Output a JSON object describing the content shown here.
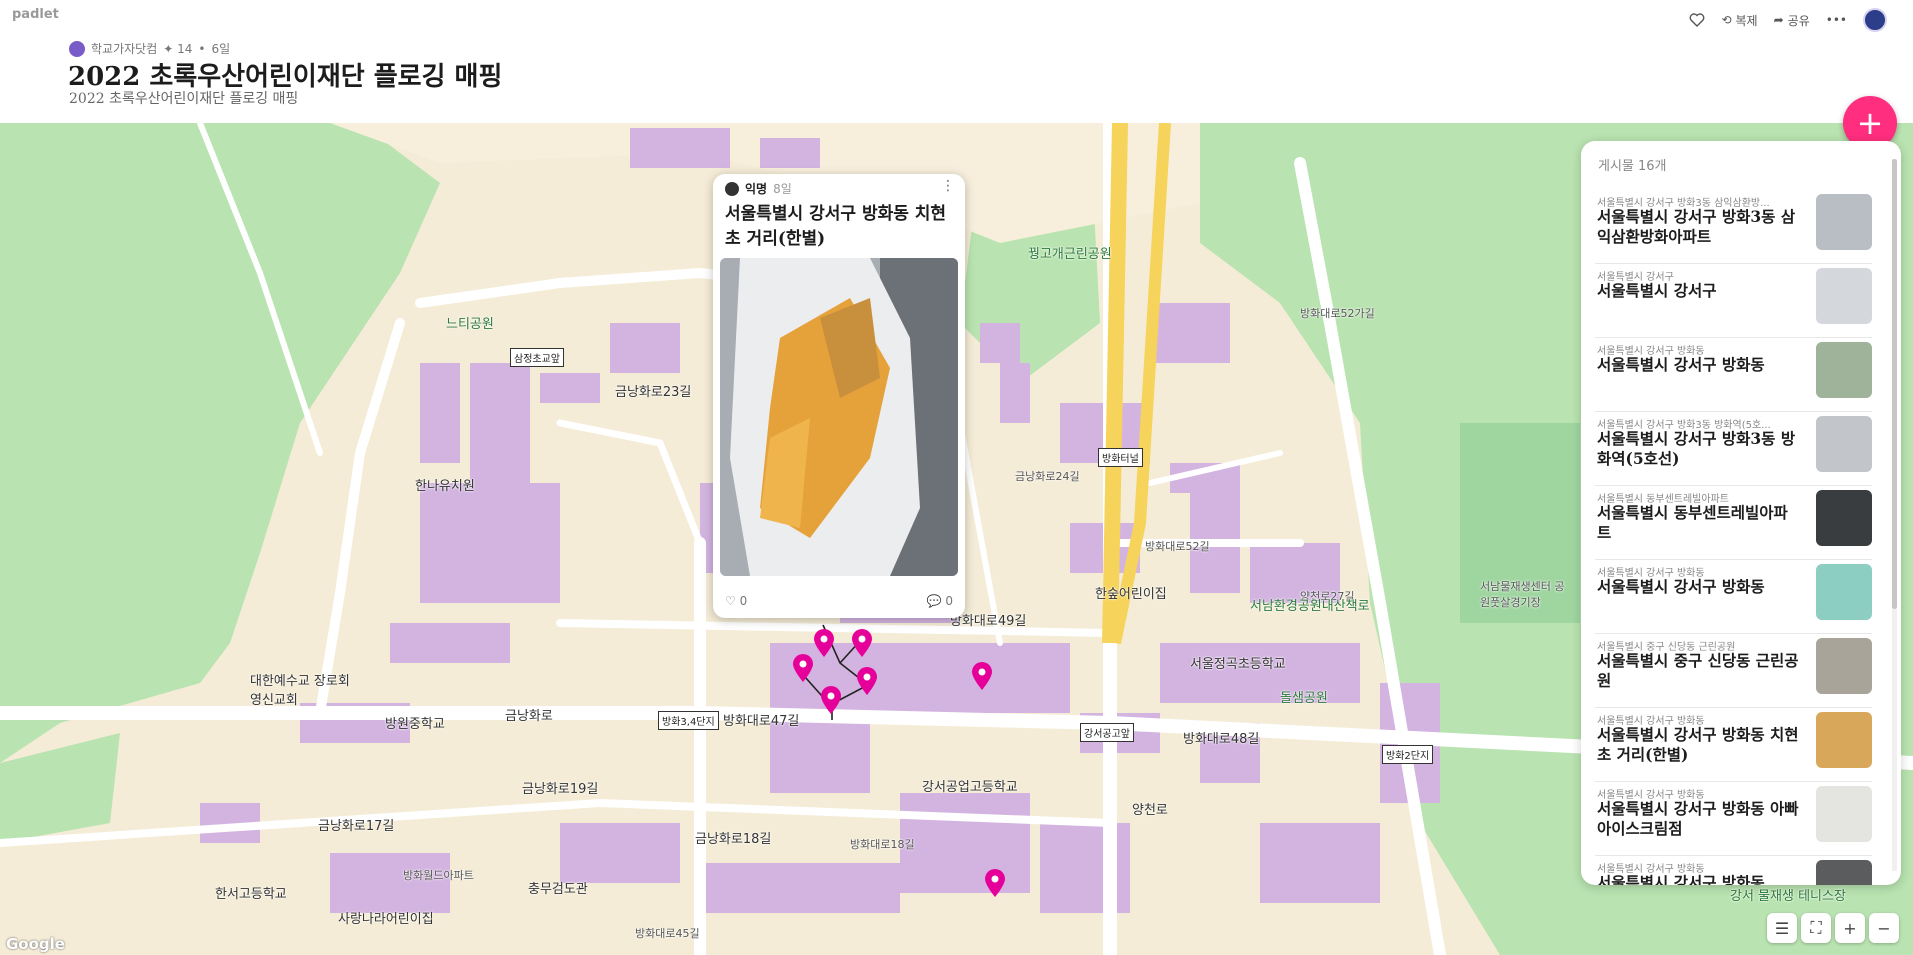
{
  "app": {
    "logo": "padlet"
  },
  "header": {
    "author": "학교가자닷컴",
    "likes": "✦ 14",
    "age": "6일",
    "title": "2022 초록우산어린이재단 플로깅 매핑",
    "subtitle": "2022 초록우산어린이재단 플로깅 매핑",
    "actions": {
      "remake": "복제",
      "share": "공유"
    }
  },
  "map": {
    "labels": [
      {
        "text": "금낭화로",
        "kind": "road"
      },
      {
        "text": "금낭화로23길",
        "kind": "road"
      },
      {
        "text": "금낭화로17길",
        "kind": "road"
      },
      {
        "text": "금낭화로19길",
        "kind": "road"
      },
      {
        "text": "금낭화로18길",
        "kind": "road"
      },
      {
        "text": "방화대로47길",
        "kind": "road"
      },
      {
        "text": "방화대로48길",
        "kind": "road"
      },
      {
        "text": "방화대로49길",
        "kind": "road"
      },
      {
        "text": "방화대로52길",
        "kind": "road"
      },
      {
        "text": "방화대로52가길",
        "kind": "road"
      },
      {
        "text": "방화대로45길",
        "kind": "road"
      },
      {
        "text": "양천로",
        "kind": "road"
      },
      {
        "text": "양천로27길",
        "kind": "road"
      },
      {
        "text": "금낭화로24길",
        "kind": "road"
      },
      {
        "text": "방화대로18길",
        "kind": "road"
      },
      {
        "text": "느티공원",
        "kind": "park"
      },
      {
        "text": "꿩고개근린공원",
        "kind": "park"
      },
      {
        "text": "돌샘공원",
        "kind": "park"
      },
      {
        "text": "서남환경공원내산책로",
        "kind": "park"
      },
      {
        "text": "서남물재생센터 공원풋살경기장",
        "kind": "park"
      },
      {
        "text": "강서 물재생 테니스장",
        "kind": "park"
      },
      {
        "text": "한나유치원",
        "kind": "poi"
      },
      {
        "text": "한숲어린이집",
        "kind": "poi"
      },
      {
        "text": "서울정곡초등학교",
        "kind": "poi"
      },
      {
        "text": "강서공업고등학교",
        "kind": "poi"
      },
      {
        "text": "방원중학교",
        "kind": "poi"
      },
      {
        "text": "대한예수교 장로회 영신교회",
        "kind": "poi"
      },
      {
        "text": "한서고등학교",
        "kind": "poi"
      },
      {
        "text": "사랑나라어린이집",
        "kind": "poi"
      },
      {
        "text": "충무검도관",
        "kind": "poi"
      },
      {
        "text": "방화월드아파트",
        "kind": "poi"
      }
    ],
    "bus_stops": [
      "삼정초교앞",
      "방화터널",
      "방화3,4단지",
      "강서공고앞",
      "방화2단지"
    ],
    "attribution": "Google"
  },
  "popup": {
    "author": "익명",
    "age": "8일",
    "title": "서울특별시 강서구 방화동 치현초 거리(한별)",
    "likes": "0",
    "comments": "0"
  },
  "panel": {
    "count": "게시물 16개",
    "posts": [
      {
        "caption": "서울특별시 강서구 방화3동 삼익삼환방...",
        "title": "서울특별시 강서구 방화3동 삼익삼환방화아파트"
      },
      {
        "caption": "서울특별시 강서구",
        "title": "서울특별시 강서구"
      },
      {
        "caption": "서울특별시 강서구 방화동",
        "title": "서울특별시 강서구 방화동"
      },
      {
        "caption": "서울특별시 강서구 방화3동 방화역(5호...",
        "title": "서울특별시 강서구 방화3동 방화역(5호선)"
      },
      {
        "caption": "서울특별시 동부센트레빌아파트",
        "title": "서울특별시 동부센트레빌아파트"
      },
      {
        "caption": "서울특별시 강서구 방화동",
        "title": "서울특별시 강서구 방화동"
      },
      {
        "caption": "서울특별시 중구 신당동 근린공원",
        "title": "서울특별시 중구 신당동 근린공원"
      },
      {
        "caption": "서울특별시 강서구 방화동",
        "title": "서울특별시 강서구 방화동 치현초 거리(한별)"
      },
      {
        "caption": "서울특별시 강서구 방화동",
        "title": "서울특별시 강서구 방화동 아빠 아이스크림점"
      },
      {
        "caption": "서울특별시 강서구 방화동",
        "title": "서울특별시 강서구 방화동"
      }
    ]
  },
  "colors": {
    "accent": "#ff2e7e",
    "pin": "#e6009a",
    "park": "#b9e3b0",
    "building": "#d3b4e0",
    "road": "#ffffff",
    "land": "#f4ecd6",
    "highway": "#f6d35a"
  }
}
